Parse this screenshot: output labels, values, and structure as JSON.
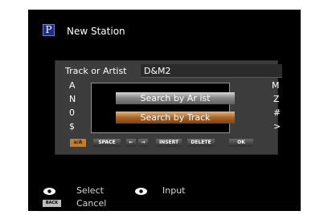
{
  "header": {
    "icon_letter": "P",
    "title": "New Station"
  },
  "field": {
    "label": "Track or Artist",
    "value": "D&M2"
  },
  "side_chars": {
    "left": [
      "A",
      "N",
      "0",
      "$"
    ],
    "right": [
      "M",
      "Z",
      "#",
      ">"
    ]
  },
  "popup": {
    "options": [
      "Search by Ar ist",
      "Search by Track"
    ],
    "selected_index": 1
  },
  "keyboard": {
    "keys": [
      "a/A",
      "SPACE",
      "←",
      "→",
      "INSERT",
      "DELETE",
      "OK"
    ],
    "active_key_index": 0
  },
  "legend": {
    "select_label": "Select",
    "input_label": "Input",
    "back_key": "BACK",
    "cancel_label": "Cancel"
  }
}
